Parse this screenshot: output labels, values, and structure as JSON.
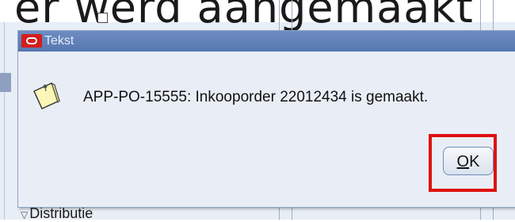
{
  "background": {
    "caption": "er werd aangemaakt",
    "section_label": "Distributie"
  },
  "dialog": {
    "title": "Tekst",
    "message": "APP-PO-15555: Inkooporder 22012434 is gemaakt.",
    "ok_label_underlined": "O",
    "ok_label_rest": "K"
  },
  "icons": {
    "app_icon": "oracle-icon",
    "message_icon": "note-icon",
    "close_icon": "close-icon"
  },
  "colors": {
    "titlebar": "#5f7fb8",
    "dialog_bg": "#e9eef6",
    "highlight": "#e01010",
    "oracle_red": "#d41d1d"
  }
}
